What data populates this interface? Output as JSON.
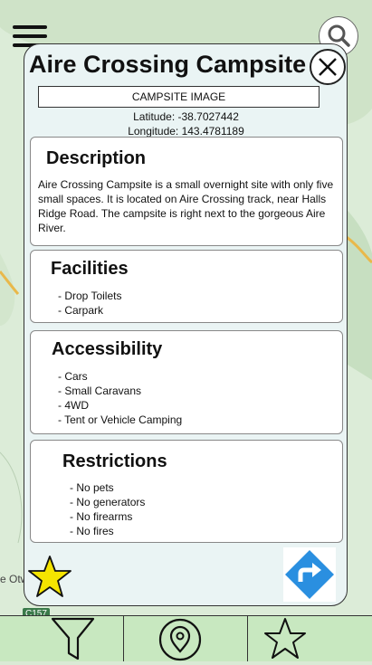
{
  "map": {
    "place_label": "e Otw",
    "road_badge": "C157"
  },
  "header": {
    "menu_icon": "hamburger-menu-icon",
    "search_icon": "search-icon"
  },
  "campsite": {
    "title": "Aire Crossing Campsite",
    "image_placeholder": "CAMPSITE IMAGE",
    "latitude": "Latitude: -38.7027442",
    "longitude": "Longitude: 143.4781189",
    "description": {
      "heading": "Description",
      "text": "Aire Crossing Campsite is a small overnight site with only five small spaces. It is located on Aire Crossing track, near Halls Ridge Road. The campsite is right next to the gorgeous Aire River."
    },
    "facilities": {
      "heading": "Facilities",
      "items": [
        "- Drop Toilets",
        "- Carpark"
      ]
    },
    "accessibility": {
      "heading": "Accessibility",
      "items": [
        "- Cars",
        "- Small Caravans",
        "- 4WD",
        "- Tent or Vehicle Camping"
      ]
    },
    "restrictions": {
      "heading": "Restrictions",
      "items": [
        "- No pets",
        "- No generators",
        "- No firearms",
        "- No fires"
      ]
    }
  },
  "actions": {
    "favorite_icon": "star-filled-icon",
    "favorite_color": "#f5e400",
    "directions_icon": "directions-icon",
    "directions_color": "#2a8fe0",
    "close_icon": "close-icon"
  },
  "bottom_nav": {
    "items": [
      {
        "icon": "filter-icon"
      },
      {
        "icon": "map-pin-icon"
      },
      {
        "icon": "star-outline-icon"
      }
    ]
  }
}
